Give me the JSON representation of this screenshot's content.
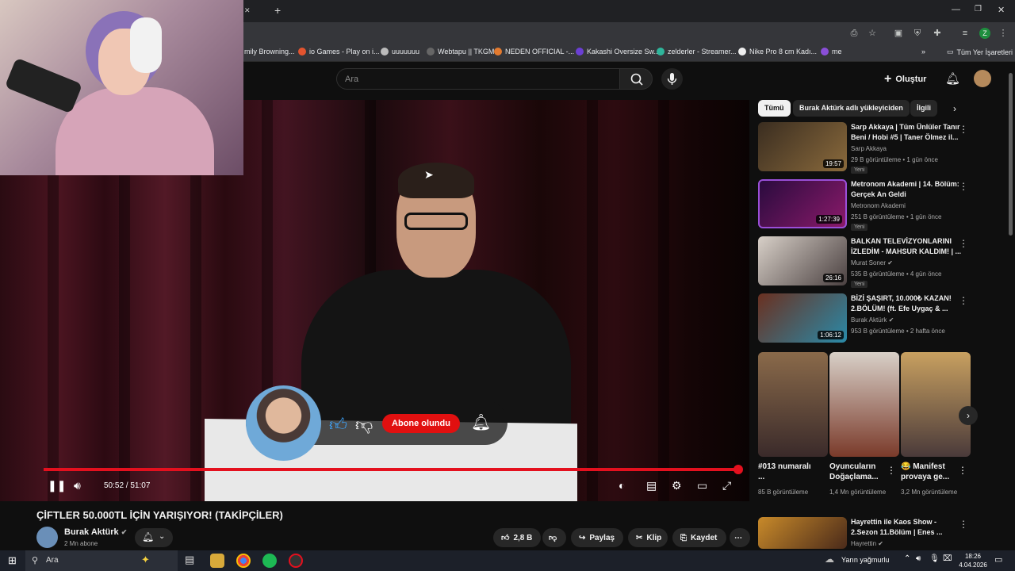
{
  "browser": {
    "bookmarks": [
      {
        "label": "mily Browning..."
      },
      {
        "label": "io Games - Play on i..."
      },
      {
        "label": "uuuuuuu"
      },
      {
        "label": "Webtapu || TKGM"
      },
      {
        "label": "NEDEN OFFICIAL -..."
      },
      {
        "label": "Kakashi Oversize Sw..."
      },
      {
        "label": "zelderler - Streamer..."
      },
      {
        "label": "Nike Pro 8 cm Kadı..."
      },
      {
        "label": "me"
      }
    ],
    "all_bookmarks": "Tüm Yer İşaretleri",
    "profile_letter": "Z"
  },
  "header": {
    "search_placeholder": "Ara",
    "create_label": "Oluştur"
  },
  "video": {
    "subscribe_label": "Abone olundu",
    "time": "50:52 / 51:07",
    "progress": 0.995,
    "title": "ÇİFTLER 50.000TL İÇİN YARIŞIYOR! (TAKİPÇİLER)",
    "channel": "Burak Aktürk",
    "subscribers": "2 Mn abone",
    "likes": "2,8 B",
    "share": "Paylaş",
    "clip": "Klip",
    "save": "Kaydet"
  },
  "sidebar": {
    "chips": [
      "Tümü",
      "Burak Aktürk adlı yükleyiciden",
      "İlgili"
    ],
    "recs": [
      {
        "title": "Sarp Akkaya | Tüm Ünlüler Tanır Beni / Hobi #5 | Taner Ölmez il...",
        "channel": "Sarp Akkaya",
        "meta": "29 B görüntüleme • 1 gün önce",
        "badge": "Yeni",
        "duration": "19:57"
      },
      {
        "title": "Metronom Akademi | 14. Bölüm: Gerçek An Geldi",
        "channel": "Metronom Akademi",
        "meta": "251 B görüntüleme • 1 gün önce",
        "badge": "Yeni",
        "duration": "1:27:39"
      },
      {
        "title": "BALKAN TELEVİZYONLARINI İZLEDİM - MAHSUR KALDIM! | ...",
        "channel": "Murat Soner",
        "meta": "535 B görüntüleme • 4 gün önce",
        "badge": "Yeni",
        "duration": "26:16"
      },
      {
        "title": "BİZİ ŞAŞIRT, 10.000₺ KAZAN! 2.BÖLÜM! (ft. Efe Uygaç & ...",
        "channel": "Burak Aktürk",
        "meta": "953 B görüntüleme • 2 hafta önce",
        "badge": "",
        "duration": "1:06:12"
      }
    ],
    "shorts": [
      {
        "title": "#013 numaralı ...",
        "views": "85 B görüntüleme"
      },
      {
        "title": "Oyuncuların Doğaçlama...",
        "views": "1,4 Mn görüntüleme"
      },
      {
        "title": "😂 Manifest provaya ge...",
        "views": "3,2 Mn görüntüleme"
      }
    ],
    "last": {
      "title": "Hayrettin ile Kaos Show - 2.Sezon 11.Bölüm | Enes ...",
      "channel": "Hayrettin"
    }
  },
  "taskbar": {
    "search": "Ara",
    "weather": "Yarın yağmurlu",
    "time": "18:26",
    "date": "4.04.2026"
  },
  "colors": {
    "accent": "#e4101e",
    "like": "#3ea6ff"
  }
}
